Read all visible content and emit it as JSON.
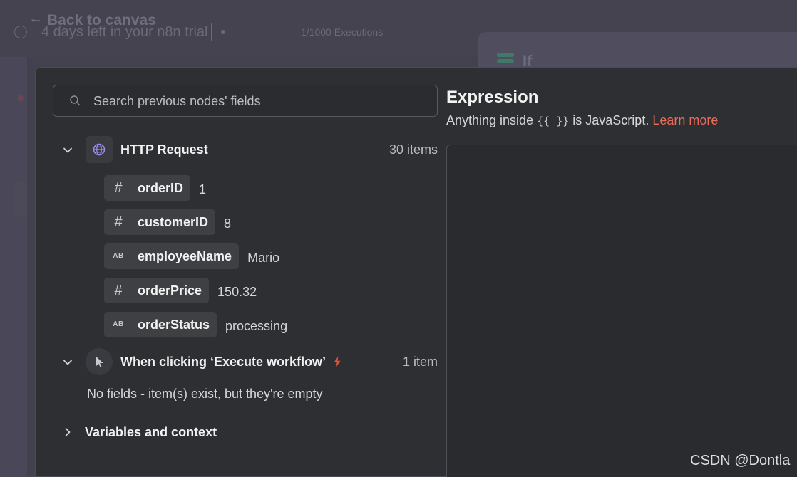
{
  "background": {
    "back_label": "Back to canvas",
    "trial_text": "4 days left in your n8n trial",
    "executions": "1/1000 Executions",
    "node_title": "If"
  },
  "search": {
    "placeholder": "Search previous nodes' fields",
    "value": ""
  },
  "nodes": [
    {
      "title": "HTTP Request",
      "count": "30 items",
      "icon": "globe-icon",
      "fields": [
        {
          "type": "number",
          "name": "orderID",
          "value": "1"
        },
        {
          "type": "number",
          "name": "customerID",
          "value": "8"
        },
        {
          "type": "string",
          "name": "employeeName",
          "value": "Mario"
        },
        {
          "type": "number",
          "name": "orderPrice",
          "value": "150.32"
        },
        {
          "type": "string",
          "name": "orderStatus",
          "value": "processing"
        }
      ]
    },
    {
      "title": "When clicking ‘Execute workflow’",
      "count": "1 item",
      "icon": "pointer-icon",
      "empty_note": "No fields - item(s) exist, but they're empty"
    }
  ],
  "field_type_labels": {
    "number": "#",
    "string": "AB"
  },
  "variables": {
    "label": "Variables and context"
  },
  "expression": {
    "title": "Expression",
    "sub_before": "Anything inside",
    "sub_code": "{{ }}",
    "sub_after": "is JavaScript.",
    "learn_more": "Learn more",
    "value": ""
  },
  "watermark": "CSDN @Dontla",
  "colors": {
    "accent_link": "#ea6b57",
    "trigger_bolt": "#e5533d",
    "globe": "#9a8cf2",
    "modal_bg": "#2e2f32"
  }
}
